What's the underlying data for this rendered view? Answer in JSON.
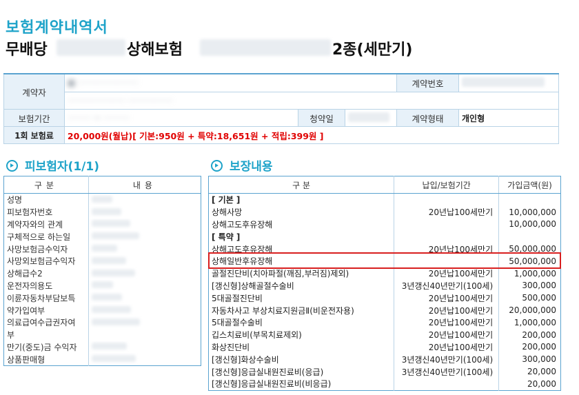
{
  "header": {
    "doc_title": "보험계약내역서",
    "product_prefix": "무배당",
    "product_middle": "상해보험",
    "product_suffix": "2종(세만기)"
  },
  "contract": {
    "contractor_label": "계약자",
    "contract_no_label": "계약번호",
    "period_label": "보험기간",
    "application_date_label": "청약일",
    "contract_type_label": "계약형태",
    "contract_type_value": "개인형",
    "premium_label": "1회 보험료",
    "premium_value": "20,000원(월납)[ 기본:950원 + 특약:18,651원 + 적립:399원 ]"
  },
  "insured": {
    "section_title": "피보험자(1/1)",
    "headers": [
      "구분",
      "내용"
    ],
    "rows": [
      "성명",
      "피보험자번호",
      "계약자와의 관계",
      "구체적으로 하는일",
      "사망보험금수익자",
      "사망외보험금수익자",
      "상해급수2",
      "운전자의용도",
      "이륜자동차부담보특",
      "약가입여부",
      "의료급여수급권자여",
      "부",
      "만기(중도)금 수익자",
      "상품판매형"
    ]
  },
  "coverage": {
    "section_title": "보장내용",
    "headers": [
      "구 분",
      "납입/보험기간",
      "가입금액(원)"
    ],
    "rows": [
      {
        "name": "[ 기본 ]",
        "period": "",
        "amount": "",
        "group": true
      },
      {
        "name": "상해사망",
        "period": "20년납100세만기",
        "amount": "10,000,000"
      },
      {
        "name": "상해고도후유장해",
        "period": "",
        "amount": "10,000,000"
      },
      {
        "name": "[ 특약 ]",
        "period": "",
        "amount": "",
        "group": true
      },
      {
        "name": "상해고도후유장해",
        "period": "20년납100세만기",
        "amount": "50,000,000"
      },
      {
        "name": "상해일반후유장해",
        "period": "",
        "amount": "50,000,000"
      },
      {
        "name": "골절진단비(치아파절(깨짐,부러짐)제외)",
        "period": "20년납100세만기",
        "amount": "1,000,000"
      },
      {
        "name": "[갱신형]상해골절수술비",
        "period": "3년갱신40년만기(100세)",
        "amount": "300,000"
      },
      {
        "name": "5대골절진단비",
        "period": "20년납100세만기",
        "amount": "500,000"
      },
      {
        "name": "자동차사고 부상치료지원금Ⅱ(비운전자용)",
        "period": "20년납100세만기",
        "amount": "20,000,000"
      },
      {
        "name": "5대골절수술비",
        "period": "20년납100세만기",
        "amount": "1,000,000"
      },
      {
        "name": "깁스치료비(부목치료제외)",
        "period": "20년납100세만기",
        "amount": "200,000"
      },
      {
        "name": "화상진단비",
        "period": "20년납100세만기",
        "amount": "200,000"
      },
      {
        "name": "[갱신형]화상수술비",
        "period": "3년갱신40년만기(100세)",
        "amount": "300,000"
      },
      {
        "name": "[갱신형]응급실내원진료비(응급)",
        "period": "3년갱신40년만기(100세)",
        "amount": "20,000"
      },
      {
        "name": "[갱신형]응급실내원진료비(비응급)",
        "period": "",
        "amount": "20,000"
      }
    ]
  },
  "colors": {
    "title": "#1ea3c9",
    "premium": "#e00000",
    "highlight": "#d81e1e"
  }
}
